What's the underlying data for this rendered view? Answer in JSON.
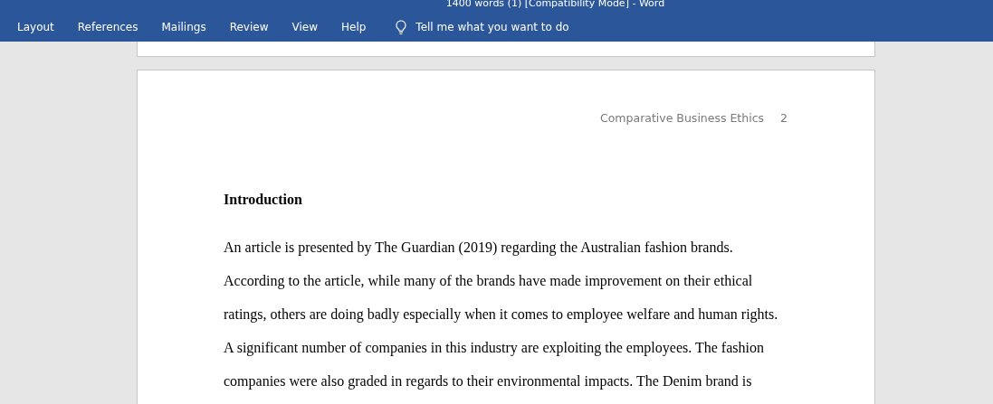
{
  "window": {
    "title": "1400 words (1) [Compatibility Mode]  -  Word"
  },
  "ribbon_tabs": [
    {
      "label": "Layout"
    },
    {
      "label": "References"
    },
    {
      "label": "Mailings"
    },
    {
      "label": "Review"
    },
    {
      "label": "View"
    },
    {
      "label": "Help"
    }
  ],
  "tell_me": {
    "label": "Tell me what you want to do"
  },
  "page": {
    "header": {
      "title": "Comparative Business Ethics",
      "page_number": "2"
    },
    "heading": "Introduction",
    "lines": [
      "An article is presented by The Guardian (2019) regarding the Australian fashion brands.",
      "According to the article, while many of the brands have made improvement on their ethical",
      "ratings, others are doing badly especially when it comes to employee welfare and human rights.",
      "A significant number of companies in this industry are exploiting the employees. The fashion",
      "companies were also graded in regards to their environmental impacts. The Denim brand is"
    ]
  }
}
